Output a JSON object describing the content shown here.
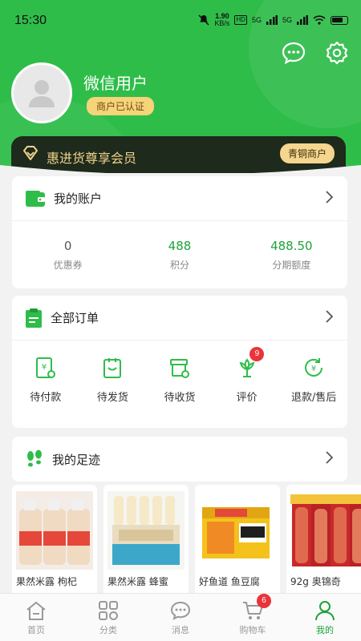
{
  "status_bar": {
    "time": "15:30",
    "speed_value": "1.90",
    "speed_unit": "KB/s",
    "hd": "HD",
    "signal1": "5G",
    "signal2": "5G"
  },
  "profile": {
    "username": "微信用户",
    "badge": "商户已认证"
  },
  "vip": {
    "text": "惠进货尊享会员",
    "level": "青铜商户"
  },
  "account": {
    "title": "我的账户",
    "stats": [
      {
        "value": "0",
        "label": "优惠券",
        "highlight": false
      },
      {
        "value": "488",
        "label": "积分",
        "highlight": true
      },
      {
        "value": "488.50",
        "label": "分期额度",
        "highlight": true
      }
    ]
  },
  "orders": {
    "title": "全部订单",
    "items": [
      {
        "label": "待付款",
        "icon": "payment-icon"
      },
      {
        "label": "待发货",
        "icon": "shipping-icon"
      },
      {
        "label": "待收货",
        "icon": "receive-icon"
      },
      {
        "label": "评价",
        "icon": "review-icon",
        "badge": "9"
      },
      {
        "label": "退款/售后",
        "icon": "refund-icon"
      }
    ]
  },
  "footprint": {
    "title": "我的足迹",
    "products": [
      {
        "name": "果然米露 枸杞",
        "image": "milk-bottles"
      },
      {
        "name": "果然米露 蜂蜜",
        "image": "rice-drink-box"
      },
      {
        "name": "好鱼道 鱼豆腐",
        "image": "fish-tofu-box"
      },
      {
        "name": "92g 奥锦奇",
        "image": "sausage-pack"
      }
    ]
  },
  "tabbar": {
    "tabs": [
      {
        "label": "首页",
        "icon": "home-icon"
      },
      {
        "label": "分类",
        "icon": "category-icon"
      },
      {
        "label": "消息",
        "icon": "message-icon"
      },
      {
        "label": "购物车",
        "icon": "cart-icon",
        "badge": "6"
      },
      {
        "label": "我的",
        "icon": "profile-icon",
        "active": true
      }
    ]
  },
  "colors": {
    "brand": "#2fbd4a",
    "accent_green": "#1ea23a",
    "badge_red": "#e8343a",
    "vip_gold": "#f5d68e",
    "vip_dark": "#1e2a1c"
  }
}
